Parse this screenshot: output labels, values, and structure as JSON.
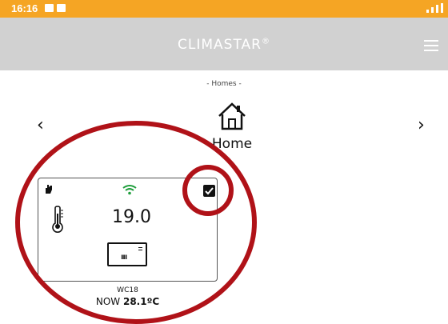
{
  "status_bar": {
    "time": "16:16"
  },
  "header": {
    "brand": "CLIMASTAR",
    "brand_mark": "®"
  },
  "homes": {
    "label": "- Homes -",
    "home_name": "Home",
    "prev": "‹",
    "next": "›"
  },
  "device_card": {
    "temperature": "19.0",
    "device_name": "WC18",
    "now_prefix": "NOW",
    "now_value": "28.1ºC",
    "heater_symbol": "ııı",
    "selected": true
  },
  "colors": {
    "status_bar": "#f5a524",
    "header": "#d1d1d1",
    "wifi": "#1f9e3c",
    "annotation": "#b01218"
  },
  "icons": [
    "image-icon",
    "mail-icon",
    "menu-icon",
    "house-icon",
    "hand-icon",
    "wifi-icon",
    "checkbox-icon",
    "thermometer-icon",
    "heater-icon"
  ]
}
